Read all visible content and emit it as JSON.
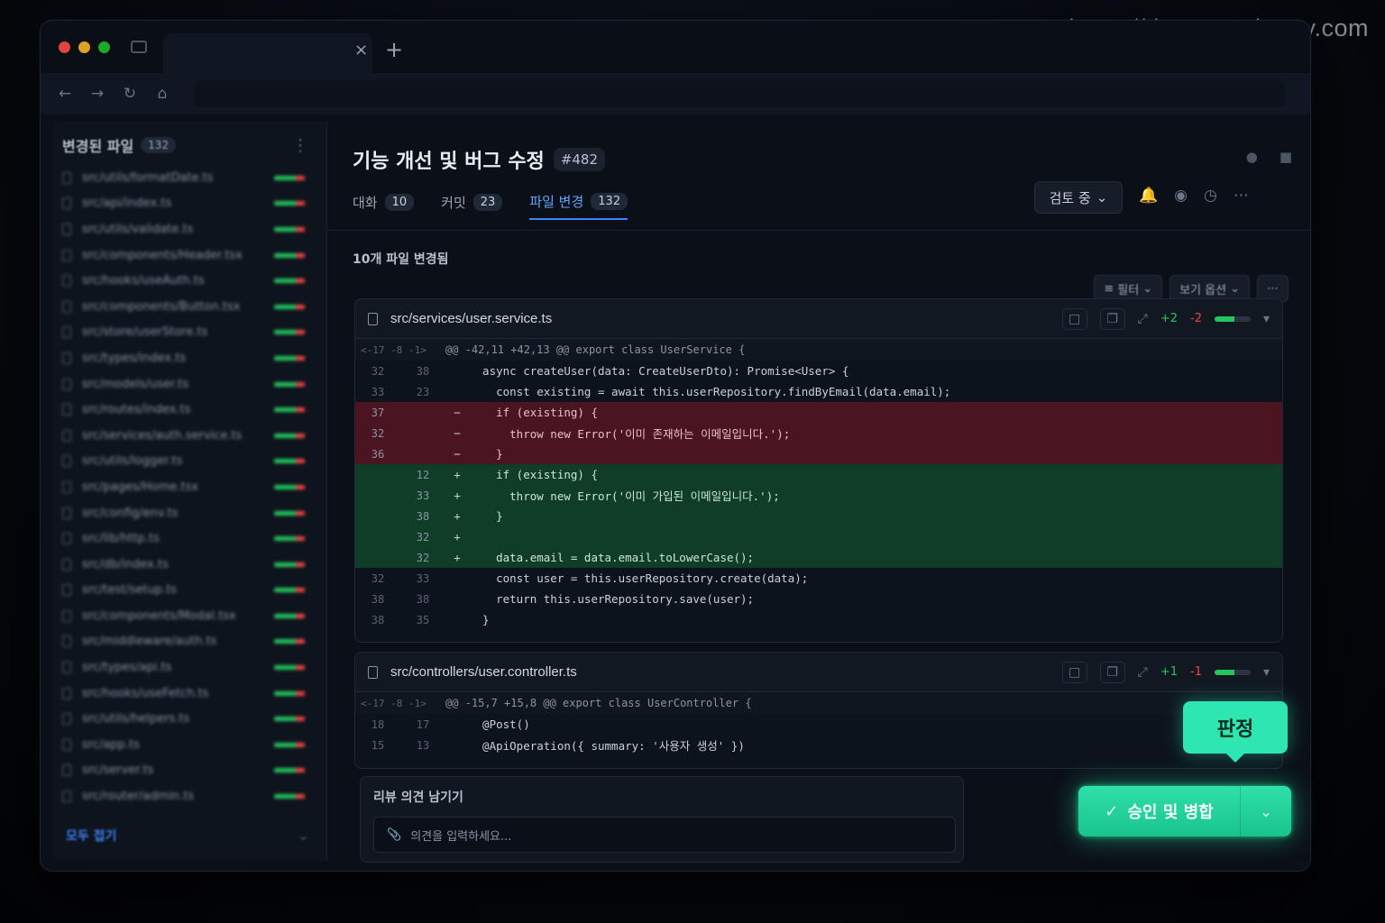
{
  "watermark": "https://devconq.tistory.com",
  "browser": {
    "tab_close": "×",
    "tab_new": "+"
  },
  "sidebar": {
    "title": "변경된 파일",
    "count": "132",
    "footer": "모두 접기",
    "files": [
      "src/utils/formatDate.ts",
      "src/api/index.ts",
      "src/utils/validate.ts",
      "src/components/Header.tsx",
      "src/hooks/useAuth.ts",
      "src/components/Button.tsx",
      "src/store/userStore.ts",
      "src/types/index.ts",
      "src/models/user.ts",
      "src/routes/index.ts",
      "src/services/auth.service.ts",
      "src/utils/logger.ts",
      "src/pages/Home.tsx",
      "src/config/env.ts",
      "src/lib/http.ts",
      "src/db/index.ts",
      "src/test/setup.ts",
      "src/components/Modal.tsx",
      "src/middleware/auth.ts",
      "src/types/api.ts",
      "src/hooks/useFetch.ts",
      "src/utils/helpers.ts",
      "src/app.ts",
      "src/server.ts",
      "src/router/admin.ts"
    ]
  },
  "header": {
    "title": "기능 개선 및 버그 수정",
    "number": "#482",
    "status": "검토 중",
    "tabs": [
      {
        "label": "대화",
        "count": "10"
      },
      {
        "label": "커밋",
        "count": "23"
      },
      {
        "label": "파일 변경",
        "count": "132"
      }
    ]
  },
  "main": {
    "files_changed": "10개 파일 변경됨",
    "filter": "필터",
    "view_options": "보기 옵션"
  },
  "diff1": {
    "path": "src/services/user.service.ts",
    "add": "+2",
    "del": "-2",
    "hunk_nav": "<-17 -8 -1>",
    "hunk": "@@ -42,11 +42,13 @@ export class UserService {",
    "lines": [
      {
        "type": "ctx",
        "old": "32",
        "new": "38",
        "sign": "",
        "code": "  async createUser(data: CreateUserDto): Promise<User> {"
      },
      {
        "type": "ctx",
        "old": "33",
        "new": "23",
        "sign": "",
        "code": "    const existing = await this.userRepository.findByEmail(data.email);"
      },
      {
        "type": "del",
        "old": "37",
        "new": "",
        "sign": "−",
        "code": "    if (existing) {"
      },
      {
        "type": "del",
        "old": "32",
        "new": "",
        "sign": "−",
        "code": "      throw new Error('이미 존재하는 이메일입니다.');"
      },
      {
        "type": "del",
        "old": "36",
        "new": "",
        "sign": "−",
        "code": "    }"
      },
      {
        "type": "add",
        "old": "",
        "new": "12",
        "sign": "+",
        "code": "    if (existing) {"
      },
      {
        "type": "add",
        "old": "",
        "new": "33",
        "sign": "+",
        "code": "      throw new Error('이미 가입된 이메일입니다.');"
      },
      {
        "type": "add",
        "old": "",
        "new": "38",
        "sign": "+",
        "code": "    }"
      },
      {
        "type": "add",
        "old": "",
        "new": "32",
        "sign": "+",
        "code": ""
      },
      {
        "type": "add",
        "old": "",
        "new": "32",
        "sign": "+",
        "code": "    data.email = data.email.toLowerCase();"
      },
      {
        "type": "ctx",
        "old": "32",
        "new": "33",
        "sign": "",
        "code": "    const user = this.userRepository.create(data);"
      },
      {
        "type": "ctx",
        "old": "38",
        "new": "38",
        "sign": "",
        "code": "    return this.userRepository.save(user);"
      },
      {
        "type": "ctx",
        "old": "38",
        "new": "35",
        "sign": "",
        "code": "  }"
      }
    ]
  },
  "diff2": {
    "path": "src/controllers/user.controller.ts",
    "add": "+1",
    "del": "-1",
    "hunk_nav": "<-17 -8 -1>",
    "hunk": "@@ -15,7 +15,8 @@ export class UserController {",
    "lines": [
      {
        "type": "ctx",
        "old": "18",
        "new": "17",
        "sign": "",
        "code": "  @Post()"
      },
      {
        "type": "ctx",
        "old": "15",
        "new": "13",
        "sign": "",
        "code": "  @ApiOperation({ summary: '사용자 생성' })"
      }
    ]
  },
  "review": {
    "title": "리뷰 의견 남기기",
    "placeholder": "의견을 입력하세요..."
  },
  "approve": {
    "label": "승인 및 병합",
    "tooltip": "판정"
  },
  "colors": {
    "accent": "#2ee6b0",
    "add": "#0f3d28",
    "del": "#4a1420",
    "link": "#3b82f6"
  }
}
